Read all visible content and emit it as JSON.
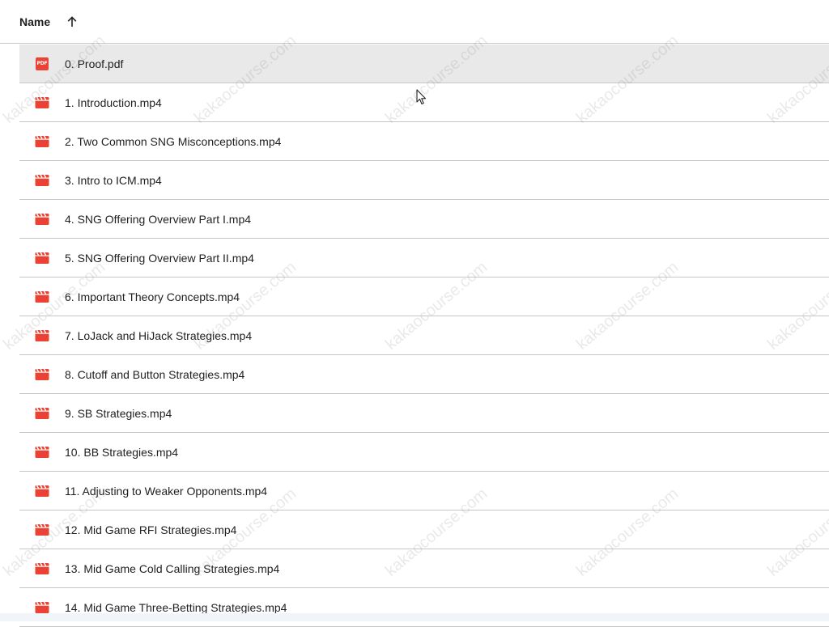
{
  "header": {
    "name_label": "Name",
    "sort_icon": "arrow-up-icon"
  },
  "files": [
    {
      "name": "0. Proof.pdf",
      "type": "pdf",
      "selected": true
    },
    {
      "name": "1. Introduction.mp4",
      "type": "video"
    },
    {
      "name": "2. Two Common SNG Misconceptions.mp4",
      "type": "video"
    },
    {
      "name": "3. Intro to ICM.mp4",
      "type": "video"
    },
    {
      "name": "4. SNG Offering Overview Part I.mp4",
      "type": "video"
    },
    {
      "name": "5. SNG Offering Overview Part II.mp4",
      "type": "video"
    },
    {
      "name": "6. Important Theory Concepts.mp4",
      "type": "video"
    },
    {
      "name": "7. LoJack and HiJack Strategies.mp4",
      "type": "video"
    },
    {
      "name": "8. Cutoff and Button Strategies.mp4",
      "type": "video"
    },
    {
      "name": "9. SB Strategies.mp4",
      "type": "video"
    },
    {
      "name": "10. BB Strategies.mp4",
      "type": "video"
    },
    {
      "name": "11. Adjusting to Weaker Opponents.mp4",
      "type": "video"
    },
    {
      "name": "12. Mid Game RFI Strategies.mp4",
      "type": "video"
    },
    {
      "name": "13. Mid Game Cold Calling Strategies.mp4",
      "type": "video"
    },
    {
      "name": "14. Mid Game Three-Betting Strategies.mp4",
      "type": "video"
    }
  ],
  "pdf_icon_label": "PDF",
  "watermark_text": "kakaocourse.com",
  "colors": {
    "file_icon_red": "#ea4335",
    "selected_row": "#e9e9e9",
    "divider": "#c7c7c7"
  }
}
